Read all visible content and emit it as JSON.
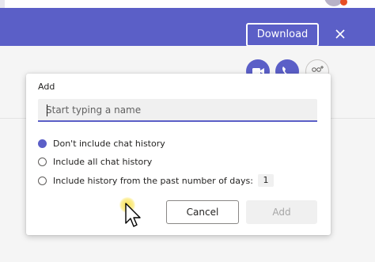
{
  "header": {
    "download_label": "Download"
  },
  "dialog": {
    "title": "Add",
    "name_input": {
      "placeholder": "Start typing a name",
      "value": ""
    },
    "options": [
      {
        "label": "Don't include chat history",
        "checked": true
      },
      {
        "label": "Include all chat history",
        "checked": false
      },
      {
        "label": "Include history from the past number of days:",
        "checked": false
      }
    ],
    "days_value": "1",
    "cancel_label": "Cancel",
    "add_label": "Add"
  },
  "colors": {
    "accent": "#5b5fc7",
    "disabled_text": "#a6a6a6"
  },
  "icons": {
    "close": "close-icon",
    "video": "video-call-icon",
    "call": "audio-call-icon",
    "people": "add-people-icon",
    "cursor": "mouse-pointer-icon"
  }
}
